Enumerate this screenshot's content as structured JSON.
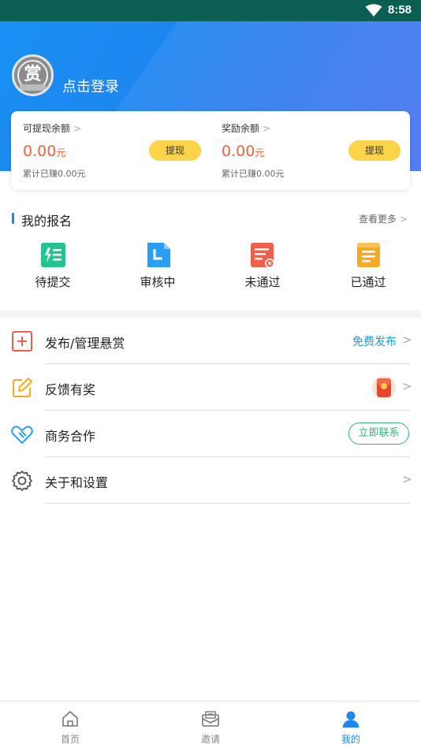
{
  "status_bar": {
    "time": "8:58"
  },
  "profile": {
    "login_text": "点击登录",
    "avatar_text": "赏"
  },
  "balances": [
    {
      "label": "可提现余额",
      "amount": "0.00",
      "unit": "元",
      "earned": "累计已赚0.00元",
      "button": "提现"
    },
    {
      "label": "奖励余额",
      "amount": "0.00",
      "unit": "元",
      "earned": "累计已赚0.00元",
      "button": "提现"
    }
  ],
  "signups": {
    "title": "我的报名",
    "more": "查看更多",
    "items": [
      {
        "label": "待提交",
        "icon": "pending-submit-icon",
        "color": "#23c48e"
      },
      {
        "label": "审核中",
        "icon": "under-review-icon",
        "color": "#2a9df4"
      },
      {
        "label": "未通过",
        "icon": "rejected-icon",
        "color": "#ef5f4b"
      },
      {
        "label": "已通过",
        "icon": "approved-icon",
        "color": "#f7a928"
      }
    ]
  },
  "menu": [
    {
      "label": "发布/管理悬赏",
      "extra": "免费发布",
      "icon": "plus-square-icon"
    },
    {
      "label": "反馈有奖",
      "extra": "",
      "icon": "edit-icon",
      "badge_icon": "red-packet-icon"
    },
    {
      "label": "商务合作",
      "extra": "立即联系",
      "icon": "handshake-icon"
    },
    {
      "label": "关于和设置",
      "extra": "",
      "icon": "gear-icon"
    }
  ],
  "tabs": [
    {
      "label": "首页",
      "icon": "home-icon",
      "active": false
    },
    {
      "label": "邀请",
      "icon": "invite-mail-icon",
      "active": false
    },
    {
      "label": "我的",
      "icon": "profile-icon",
      "active": true
    }
  ],
  "colors": {
    "primary": "#1e88f0",
    "amount": "#f1613a",
    "button": "#fcd44a",
    "link": "#1e9ad6",
    "contact": "#34b37a",
    "status_bar": "#0b5e52"
  }
}
